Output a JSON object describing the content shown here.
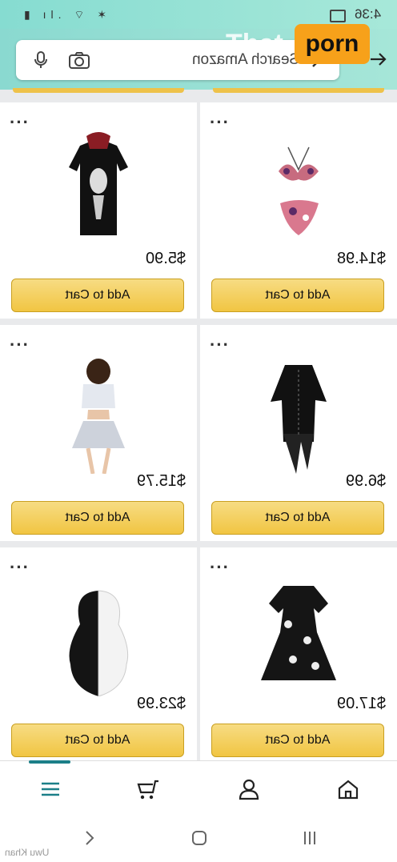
{
  "app": {
    "search_placeholder": "Search Amazon",
    "time": "4:36",
    "watermark": {
      "word": "That",
      "badge": "porn"
    },
    "credit": "Uwu Khan"
  },
  "products": [
    {
      "price": "$5.90",
      "button": "Add to Cart",
      "item": "skeleton-tee"
    },
    {
      "price": "$14.98",
      "button": "Add to Cart",
      "item": "floral-bikini"
    },
    {
      "price": "$15.79",
      "button": "Add to Cart",
      "item": "crop-skirt-set"
    },
    {
      "price": "$6.99",
      "button": "Add to Cart",
      "item": "gothic-corset-dress"
    },
    {
      "price": "$23.99",
      "button": "Add to Cart",
      "item": "black-white-wig"
    },
    {
      "price": "$17.09",
      "button": "Add to Cart",
      "item": "print-dress"
    }
  ],
  "nav": [
    "menu-icon",
    "cart-icon",
    "account-icon",
    "home-icon"
  ],
  "colors": {
    "header": "#8ad9d0",
    "button": "#f1c542",
    "accent": "#1b7f88",
    "badge": "#f7a11a"
  }
}
